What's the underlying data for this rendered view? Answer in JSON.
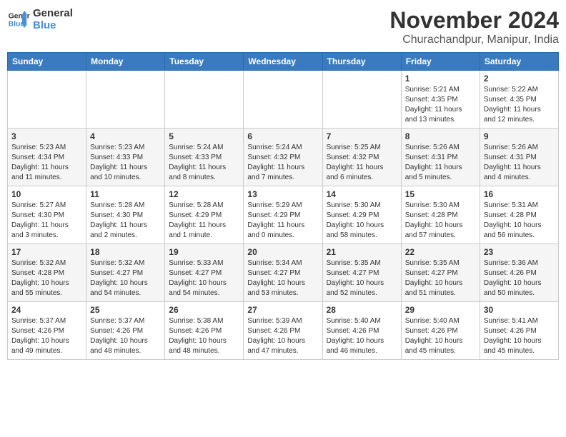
{
  "header": {
    "logo_line1": "General",
    "logo_line2": "Blue",
    "month": "November 2024",
    "location": "Churachandpur, Manipur, India"
  },
  "weekdays": [
    "Sunday",
    "Monday",
    "Tuesday",
    "Wednesday",
    "Thursday",
    "Friday",
    "Saturday"
  ],
  "weeks": [
    [
      {
        "day": "",
        "info": ""
      },
      {
        "day": "",
        "info": ""
      },
      {
        "day": "",
        "info": ""
      },
      {
        "day": "",
        "info": ""
      },
      {
        "day": "",
        "info": ""
      },
      {
        "day": "1",
        "info": "Sunrise: 5:21 AM\nSunset: 4:35 PM\nDaylight: 11 hours and 13 minutes."
      },
      {
        "day": "2",
        "info": "Sunrise: 5:22 AM\nSunset: 4:35 PM\nDaylight: 11 hours and 12 minutes."
      }
    ],
    [
      {
        "day": "3",
        "info": "Sunrise: 5:23 AM\nSunset: 4:34 PM\nDaylight: 11 hours and 11 minutes."
      },
      {
        "day": "4",
        "info": "Sunrise: 5:23 AM\nSunset: 4:33 PM\nDaylight: 11 hours and 10 minutes."
      },
      {
        "day": "5",
        "info": "Sunrise: 5:24 AM\nSunset: 4:33 PM\nDaylight: 11 hours and 8 minutes."
      },
      {
        "day": "6",
        "info": "Sunrise: 5:24 AM\nSunset: 4:32 PM\nDaylight: 11 hours and 7 minutes."
      },
      {
        "day": "7",
        "info": "Sunrise: 5:25 AM\nSunset: 4:32 PM\nDaylight: 11 hours and 6 minutes."
      },
      {
        "day": "8",
        "info": "Sunrise: 5:26 AM\nSunset: 4:31 PM\nDaylight: 11 hours and 5 minutes."
      },
      {
        "day": "9",
        "info": "Sunrise: 5:26 AM\nSunset: 4:31 PM\nDaylight: 11 hours and 4 minutes."
      }
    ],
    [
      {
        "day": "10",
        "info": "Sunrise: 5:27 AM\nSunset: 4:30 PM\nDaylight: 11 hours and 3 minutes."
      },
      {
        "day": "11",
        "info": "Sunrise: 5:28 AM\nSunset: 4:30 PM\nDaylight: 11 hours and 2 minutes."
      },
      {
        "day": "12",
        "info": "Sunrise: 5:28 AM\nSunset: 4:29 PM\nDaylight: 11 hours and 1 minute."
      },
      {
        "day": "13",
        "info": "Sunrise: 5:29 AM\nSunset: 4:29 PM\nDaylight: 11 hours and 0 minutes."
      },
      {
        "day": "14",
        "info": "Sunrise: 5:30 AM\nSunset: 4:29 PM\nDaylight: 10 hours and 58 minutes."
      },
      {
        "day": "15",
        "info": "Sunrise: 5:30 AM\nSunset: 4:28 PM\nDaylight: 10 hours and 57 minutes."
      },
      {
        "day": "16",
        "info": "Sunrise: 5:31 AM\nSunset: 4:28 PM\nDaylight: 10 hours and 56 minutes."
      }
    ],
    [
      {
        "day": "17",
        "info": "Sunrise: 5:32 AM\nSunset: 4:28 PM\nDaylight: 10 hours and 55 minutes."
      },
      {
        "day": "18",
        "info": "Sunrise: 5:32 AM\nSunset: 4:27 PM\nDaylight: 10 hours and 54 minutes."
      },
      {
        "day": "19",
        "info": "Sunrise: 5:33 AM\nSunset: 4:27 PM\nDaylight: 10 hours and 54 minutes."
      },
      {
        "day": "20",
        "info": "Sunrise: 5:34 AM\nSunset: 4:27 PM\nDaylight: 10 hours and 53 minutes."
      },
      {
        "day": "21",
        "info": "Sunrise: 5:35 AM\nSunset: 4:27 PM\nDaylight: 10 hours and 52 minutes."
      },
      {
        "day": "22",
        "info": "Sunrise: 5:35 AM\nSunset: 4:27 PM\nDaylight: 10 hours and 51 minutes."
      },
      {
        "day": "23",
        "info": "Sunrise: 5:36 AM\nSunset: 4:26 PM\nDaylight: 10 hours and 50 minutes."
      }
    ],
    [
      {
        "day": "24",
        "info": "Sunrise: 5:37 AM\nSunset: 4:26 PM\nDaylight: 10 hours and 49 minutes."
      },
      {
        "day": "25",
        "info": "Sunrise: 5:37 AM\nSunset: 4:26 PM\nDaylight: 10 hours and 48 minutes."
      },
      {
        "day": "26",
        "info": "Sunrise: 5:38 AM\nSunset: 4:26 PM\nDaylight: 10 hours and 48 minutes."
      },
      {
        "day": "27",
        "info": "Sunrise: 5:39 AM\nSunset: 4:26 PM\nDaylight: 10 hours and 47 minutes."
      },
      {
        "day": "28",
        "info": "Sunrise: 5:40 AM\nSunset: 4:26 PM\nDaylight: 10 hours and 46 minutes."
      },
      {
        "day": "29",
        "info": "Sunrise: 5:40 AM\nSunset: 4:26 PM\nDaylight: 10 hours and 45 minutes."
      },
      {
        "day": "30",
        "info": "Sunrise: 5:41 AM\nSunset: 4:26 PM\nDaylight: 10 hours and 45 minutes."
      }
    ]
  ]
}
